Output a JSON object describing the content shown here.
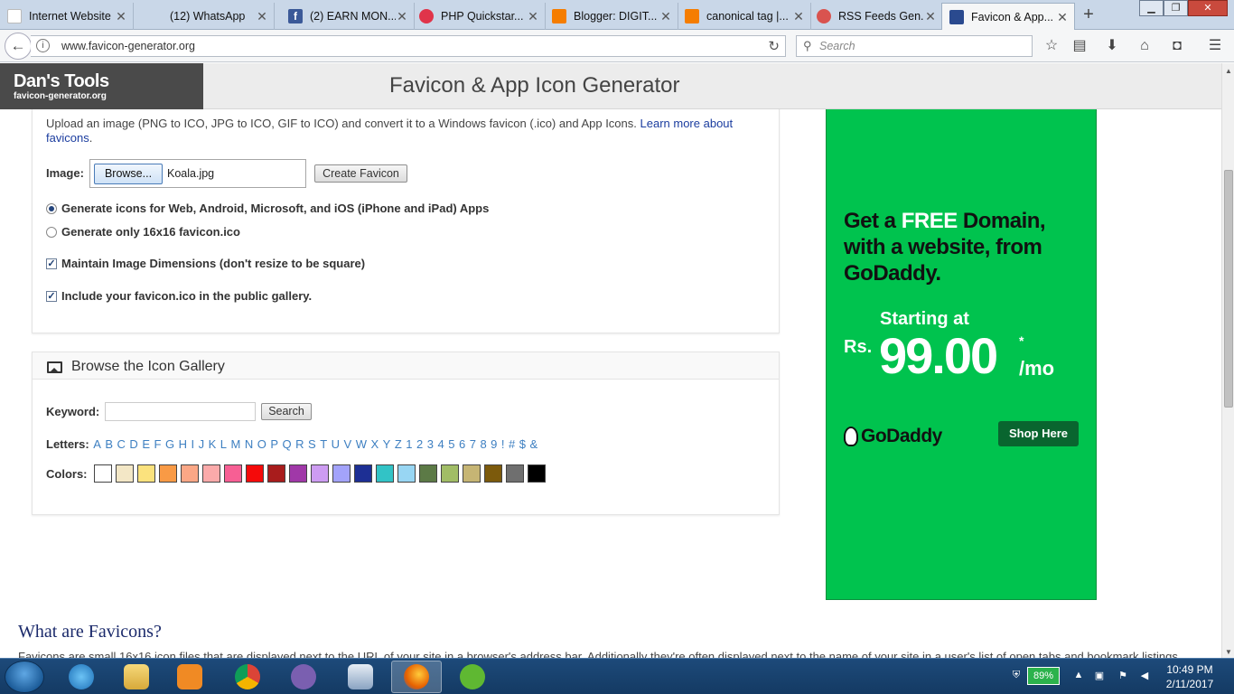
{
  "browser": {
    "tabs": [
      {
        "title": "Internet Website D...",
        "icon": "blank-page-icon",
        "color": "#ffffff"
      },
      {
        "title": "(12) WhatsApp",
        "icon": "whatsapp-icon",
        "color": "#c9d7e8"
      },
      {
        "title": "(2) EARN MON...",
        "icon": "facebook-icon",
        "color": "#3b5998"
      },
      {
        "title": "PHP Quickstar...",
        "icon": "php-icon",
        "color": "#e0344a"
      },
      {
        "title": "Blogger: DIGIT...",
        "icon": "blogger-icon",
        "color": "#f57d00"
      },
      {
        "title": "canonical tag |...",
        "icon": "blogger-icon",
        "color": "#f57d00"
      },
      {
        "title": "RSS Feeds Gen...",
        "icon": "rss-icon",
        "color": "#d9534f"
      },
      {
        "title": "Favicon & App...",
        "icon": "favicon-site-icon",
        "color": "#2a4a8f",
        "active": true
      }
    ],
    "url": "www.favicon-generator.org",
    "search_placeholder": "Search"
  },
  "site": {
    "logo_title": "Dan's Tools",
    "logo_sub": "favicon-generator.org",
    "page_title": "Favicon & App Icon Generator"
  },
  "upload": {
    "intro": "Upload an image (PNG to ICO, JPG to ICO, GIF to ICO) and convert it to a Windows favicon (.ico) and App Icons.",
    "learn_more": "Learn more about favicons",
    "intro_end": ".",
    "image_label": "Image:",
    "browse_label": "Browse...",
    "file_name": "Koala.jpg",
    "create_label": "Create Favicon",
    "option_all": "Generate icons for Web, Android, Microsoft, and iOS (iPhone and iPad) Apps",
    "option_16": "Generate only 16x16 favicon.ico",
    "maintain": "Maintain Image Dimensions (don't resize to be square)",
    "gallery_opt": "Include your favicon.ico in the public gallery."
  },
  "gallery": {
    "title": "Browse the Icon Gallery",
    "keyword_label": "Keyword:",
    "search_label": "Search",
    "letters_label": "Letters:",
    "letters": [
      "A",
      "B",
      "C",
      "D",
      "E",
      "F",
      "G",
      "H",
      "I",
      "J",
      "K",
      "L",
      "M",
      "N",
      "O",
      "P",
      "Q",
      "R",
      "S",
      "T",
      "U",
      "V",
      "W",
      "X",
      "Y",
      "Z",
      "1",
      "2",
      "3",
      "4",
      "5",
      "6",
      "7",
      "8",
      "9",
      "!",
      "#",
      "$",
      "&"
    ],
    "colors_label": "Colors:",
    "colors": [
      "#ffffff",
      "#f3e7c6",
      "#fbe27d",
      "#f99a45",
      "#fba786",
      "#fbaaaa",
      "#f75f94",
      "#f50a0a",
      "#a81c1c",
      "#a038a8",
      "#cd9cf2",
      "#a3a3fb",
      "#1d2f94",
      "#32c3c6",
      "#98d6f3",
      "#5c7a46",
      "#a1bd66",
      "#c6b574",
      "#7c5a0c",
      "#6f6f6f",
      "#000000"
    ]
  },
  "ad": {
    "headline_1": "Get a",
    "headline_free": "FREE",
    "headline_2": "Domain, with a website, from GoDaddy.",
    "starting": "Starting at",
    "currency": "Rs.",
    "price": "99.00",
    "asterisk": "*",
    "per": "/mo",
    "brand": "GoDaddy",
    "cta": "Shop Here"
  },
  "section": {
    "title": "What are Favicons?",
    "text": "Favicons are small 16x16 icon files that are displayed next to the URL of your site in a browser's address bar. Additionally they're often displayed next to the name of your site in a user's list of open tabs and bookmark listings."
  },
  "taskbar": {
    "battery": "89%",
    "time": "10:49 PM",
    "date": "2/11/2017",
    "apps": [
      "ie-icon",
      "explorer-icon",
      "media-player-icon",
      "chrome-icon",
      "app-hex-icon",
      "media-next-icon",
      "firefox-icon",
      "utorrent-icon"
    ]
  }
}
